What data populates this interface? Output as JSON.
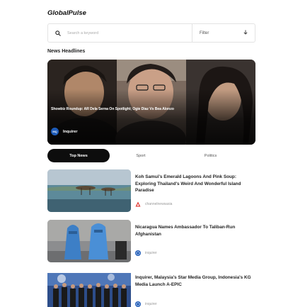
{
  "app": {
    "title": "GlobalPulse"
  },
  "search": {
    "placeholder": "Search a keyword",
    "filter_label": "Filter"
  },
  "section": {
    "title": "News Headlines"
  },
  "hero": {
    "headline": "Showbiz Roundup: AR Dela Serna On Spotlight; Ogie Diaz Vs Bea Alonzo",
    "source": "Inquirer",
    "source_logo_text": "INQ"
  },
  "tabs": [
    {
      "label": "Top News",
      "active": true
    },
    {
      "label": "Sport",
      "active": false
    },
    {
      "label": "Politics",
      "active": false
    }
  ],
  "articles": [
    {
      "title": "Koh Samui's Emerald Lagoons And Pink Soup: Exploring Thailand's Weird And Wonderful Island Paradise",
      "source": "channelnewsasia",
      "logo_color": "#e0332c",
      "icon": "cna-logo-icon"
    },
    {
      "title": "Nicaragua Names Ambassador To Taliban-Run Afghanistan",
      "source": "inquirer",
      "logo_color": "#1e5bb8",
      "icon": "inquirer-logo-icon"
    },
    {
      "title": "Inquirer, Malaysia's Star Media Group, Indonesia's KG Media Launch A-EPIC",
      "source": "inquirer",
      "logo_color": "#1e5bb8",
      "icon": "inquirer-logo-icon"
    }
  ]
}
